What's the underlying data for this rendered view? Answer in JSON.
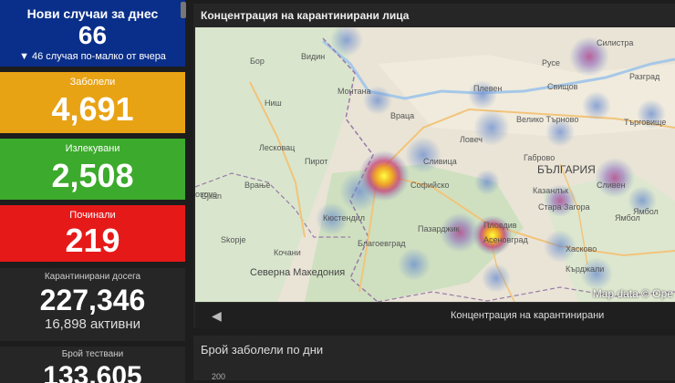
{
  "cards": {
    "new": {
      "label": "Нови случаи за днес",
      "value": "66",
      "sub": "▼ 46 случая по-малко от вчера"
    },
    "sick": {
      "label": "Заболели",
      "value": "4,691"
    },
    "healed": {
      "label": "Излекувани",
      "value": "2,508"
    },
    "dead": {
      "label": "Починали",
      "value": "219"
    },
    "quarantined": {
      "label": "Карантинирани досега",
      "value": "227,346",
      "sub": "16,898 активни"
    },
    "tests": {
      "label": "Брой тествани",
      "value": "133,605"
    }
  },
  "map": {
    "title": "Концентрация на карантинирани лица",
    "attribution": "Map data © Ope",
    "footer_caption": "Концентрация на карантинирани",
    "prev_icon": "chevron-left-icon",
    "labels": [
      "Видин",
      "Монтана",
      "Враца",
      "Плевен",
      "Русе",
      "Силистра",
      "Свищов",
      "Разград",
      "Велико Търново",
      "Търговище",
      "Ловеч",
      "Габрово",
      "БЪЛГАРИЯ",
      "Сливен",
      "Ямбол",
      "Казанлък",
      "Стара Загора",
      "Пловдив",
      "Асеновград",
      "Хасково",
      "Кърджали",
      "Пазарджик",
      "Софийско",
      "Кюстендил",
      "Благоевград",
      "Кочани",
      "Северна Македония",
      "Skopje",
      "Gjilan",
      "Врање",
      "Лесковац",
      "Ниш",
      "Бор",
      "osovo",
      "Пирот",
      "Сливица",
      "Ямбол"
    ]
  },
  "chart": {
    "title": "Брой заболели по дни",
    "tick": "200"
  },
  "colors": {
    "new_bg": "#0a2f8a",
    "sick_bg": "#e8a314",
    "healed_bg": "#3caa2c",
    "dead_bg": "#e61919",
    "panel_bg": "#262626"
  }
}
